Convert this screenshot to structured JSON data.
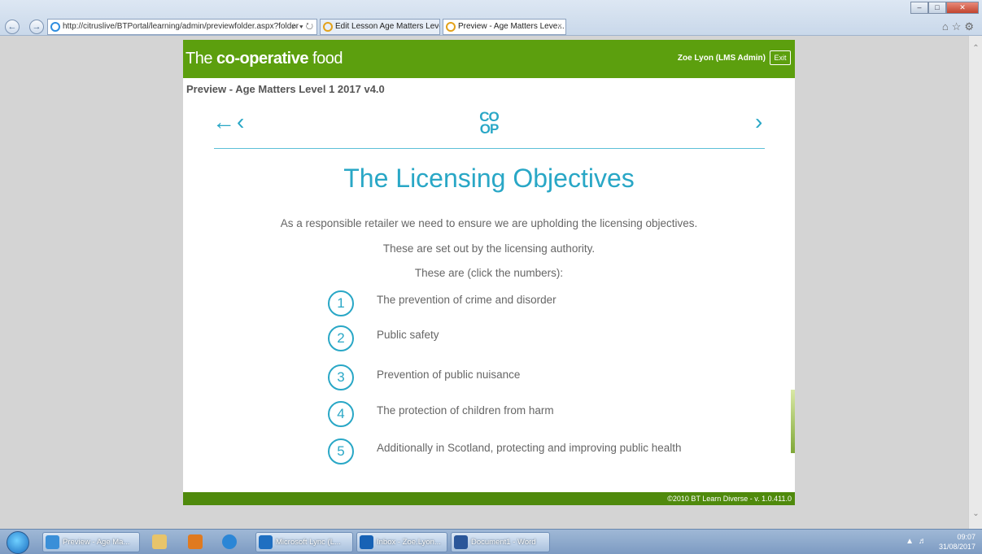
{
  "browser": {
    "url": "http://citruslive/BTPortal/learning/admin/previewfolder.aspx?folder",
    "address_controls": "⌕ ▾ ↻",
    "tabs": [
      {
        "label": "Edit Lesson Age Matters Level ..."
      },
      {
        "label": "Preview - Age Matters Leve..."
      }
    ],
    "tab_close": "×",
    "toolbar_icons": [
      "home-icon",
      "star-icon",
      "gear-icon"
    ]
  },
  "lms": {
    "brand_prefix": "The ",
    "brand_bold": "co-operative",
    "brand_suffix": " food",
    "user": "Zoe Lyon (LMS Admin)",
    "exit_label": "Exit",
    "preview_title": "Preview - Age Matters Level 1 2017 v4.0",
    "footer": "©2010 BT Learn Diverse - v. 1.0.411.0",
    "accent_color": "#29a7c6",
    "brand_color": "#5c9f0e"
  },
  "slide": {
    "nav_back_home": "←",
    "nav_prev": "‹",
    "nav_next": "›",
    "logo_top": "CO",
    "logo_bottom": "OP",
    "title": "The Licensing Objectives",
    "intro": [
      "As a responsible retailer we need to ensure we are upholding the licensing objectives.",
      "These are set out by the licensing authority.",
      "These are (click the numbers):"
    ],
    "objectives": [
      {
        "num": "1",
        "text": "The prevention of crime and disorder"
      },
      {
        "num": "2",
        "text": "Public safety"
      },
      {
        "num": "3",
        "text": "Prevention of public nuisance"
      },
      {
        "num": "4",
        "text": "The protection of children from harm"
      },
      {
        "num": "5",
        "text": "Additionally in Scotland, protecting and improving public health"
      }
    ]
  },
  "taskbar": {
    "items": [
      {
        "label": "Preview - Age Ma..."
      },
      {
        "label": "Microsoft Lync (L..."
      },
      {
        "label": "Inbox - Zoe.Lyon..."
      },
      {
        "label": "Document1 - Word"
      }
    ],
    "time": "09:07",
    "date": "31/08/2017"
  }
}
